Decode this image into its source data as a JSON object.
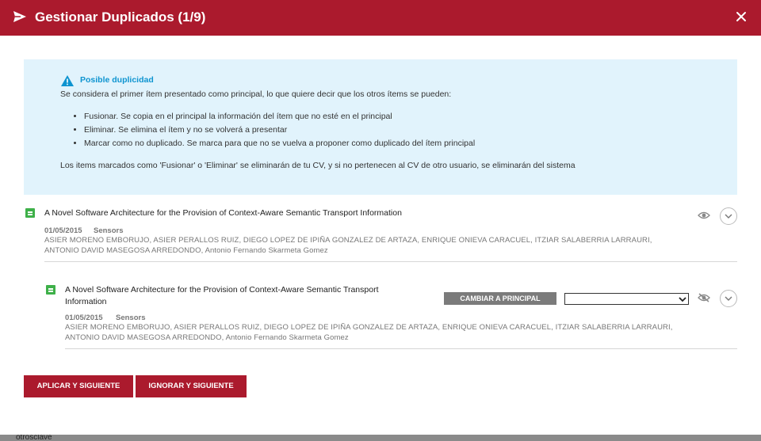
{
  "header": {
    "title": "Gestionar Duplicados (1/9)"
  },
  "info": {
    "title": "Posible duplicidad",
    "intro": "Se considera el primer ítem presentado como principal, lo que quiere decir que los otros ítems se pueden:",
    "bullets": [
      "Fusionar. Se copia en el principal la información del ítem que no esté en el principal",
      "Eliminar. Se elimina el ítem y no se volverá a presentar",
      "Marcar como no duplicado. Se marca para que no se vuelva a proponer como duplicado del ítem principal"
    ],
    "footer": "Los items marcados como 'Fusionar' o 'Eliminar' se eliminarán de tu CV, y si no pertenecen al CV de otro usuario, se eliminarán del sistema"
  },
  "items": [
    {
      "title": "A Novel Software Architecture for the Provision of Context-Aware Semantic Transport Information",
      "date": "01/05/2015",
      "source": "Sensors",
      "authors_line1": "ASIER MORENO EMBORUJO,   ASIER PERALLOS RUIZ,   DIEGO LOPEZ DE IPIÑA GONZALEZ DE ARTAZA,   ENRIQUE ONIEVA CARACUEL,   ITZIAR SALABERRIA LARRAURI,",
      "authors_line2": "ANTONIO DAVID MASEGOSA ARREDONDO,   Antonio Fernando Skarmeta Gomez"
    },
    {
      "title_line1": "A Novel Software Architecture for the Provision of Context-Aware Semantic Transport",
      "title_line2": "Information",
      "date": "01/05/2015",
      "source": "Sensors",
      "authors_line1": "ASIER MORENO EMBORUJO,   ASIER PERALLOS RUIZ,   DIEGO LOPEZ DE IPIÑA GONZALEZ DE ARTAZA,   ENRIQUE ONIEVA CARACUEL,   ITZIAR SALABERRIA LARRAURI,",
      "authors_line2": "ANTONIO DAVID MASEGOSA ARREDONDO,   Antonio Fernando Skarmeta Gomez",
      "make_principal_label": "CAMBIAR A PRINCIPAL",
      "action_select_value": ""
    }
  ],
  "buttons": {
    "apply_next": "APLICAR Y SIGUIENTE",
    "ignore_next": "IGNORAR Y SIGUIENTE"
  },
  "background": {
    "peek_text": "otrosclave"
  },
  "colors": {
    "header": "#ab1a2d",
    "info_bg": "#e1f3fc",
    "info_title": "#0d94d0",
    "item_icon": "#3eb049"
  },
  "icons": {
    "header": "send-icon",
    "close": "close-icon",
    "warning": "warning-icon",
    "item": "document-icon",
    "view": "eye-icon",
    "hide": "eye-slash-icon",
    "expand": "chevron-down-icon"
  }
}
